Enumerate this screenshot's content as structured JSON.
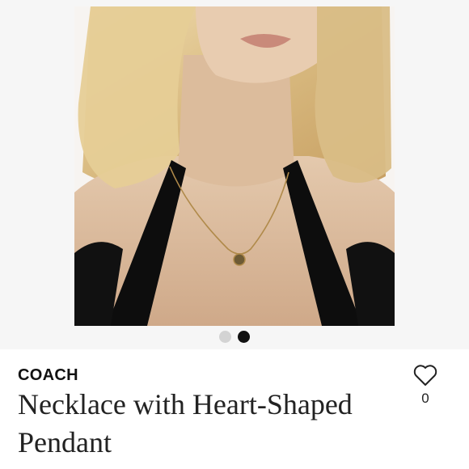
{
  "gallery": {
    "image_count": 2,
    "active_index": 2
  },
  "product": {
    "brand": "COACH",
    "title": "Necklace with Heart-Shaped Pendant"
  },
  "like": {
    "icon": "heart-outline-icon",
    "count": "0"
  },
  "colors": {
    "dot_inactive": "#d3d3d3",
    "dot_active": "#111111",
    "text": "#222222"
  }
}
